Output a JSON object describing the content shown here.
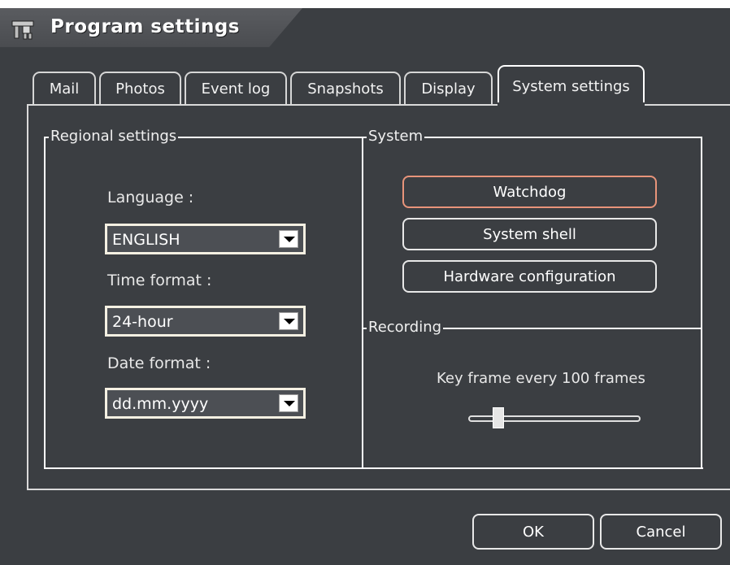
{
  "window": {
    "title": "Program settings",
    "icon": "program-settings-icon"
  },
  "tabs": [
    {
      "label": "Mail",
      "active": false
    },
    {
      "label": "Photos",
      "active": false
    },
    {
      "label": "Event log",
      "active": false
    },
    {
      "label": "Snapshots",
      "active": false
    },
    {
      "label": "Display",
      "active": false
    },
    {
      "label": "System settings",
      "active": true
    }
  ],
  "regional": {
    "group_label": "Regional settings",
    "language_label": "Language :",
    "language_value": "ENGLISH",
    "time_format_label": "Time format :",
    "time_format_value": "24-hour",
    "date_format_label": "Date format :",
    "date_format_value": "dd.mm.yyyy"
  },
  "system": {
    "group_label": "System",
    "watchdog_label": "Watchdog",
    "system_shell_label": "System shell",
    "hardware_config_label": "Hardware configuration"
  },
  "recording": {
    "group_label": "Recording",
    "keyframe_text": "Key frame every 100 frames",
    "keyframe_slider_value": 0.18
  },
  "footer": {
    "ok_label": "OK",
    "cancel_label": "Cancel"
  },
  "colors": {
    "background": "#3b3e42",
    "focus_border": "#e8947a",
    "text": "#ffffff"
  }
}
